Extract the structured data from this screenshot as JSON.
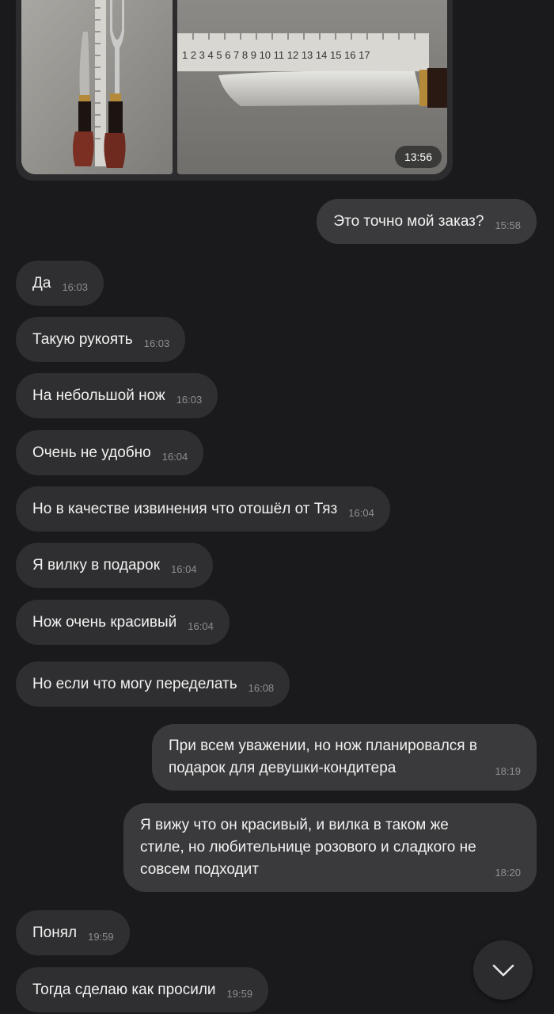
{
  "media_message": {
    "time": "13:56"
  },
  "ruler_numbers": "1 2 3 4 5 6 7 8 9 10 11 12 13 14 15 16 17",
  "messages": [
    {
      "text": "Это точно мой заказ?",
      "time": "15:58",
      "dir": "out"
    },
    {
      "text": "Да",
      "time": "16:03",
      "dir": "in"
    },
    {
      "text": "Такую рукоять",
      "time": "16:03",
      "dir": "in"
    },
    {
      "text": "На небольшой нож",
      "time": "16:03",
      "dir": "in"
    },
    {
      "text": "Очень не удобно",
      "time": "16:04",
      "dir": "in"
    },
    {
      "text": "Но в качестве извинения что отошёл от Тяз",
      "time": "16:04",
      "dir": "in"
    },
    {
      "text": "Я вилку в подарок",
      "time": "16:04",
      "dir": "in"
    },
    {
      "text": "Нож очень красивый",
      "time": "16:04",
      "dir": "in"
    },
    {
      "text": "Но если что могу переделать",
      "time": "16:08",
      "dir": "in"
    },
    {
      "lines": [
        "При всем уважении, но нож планировался в",
        "подарок для девушки-кондитера"
      ],
      "time": "18:19",
      "dir": "out"
    },
    {
      "lines": [
        "Я вижу что он красивый, и вилка в таком же",
        "стиле, но любительнице розового и сладкого не",
        "совсем подходит"
      ],
      "time": "18:20",
      "dir": "out"
    },
    {
      "text": "Понял",
      "time": "19:59",
      "dir": "in"
    },
    {
      "text": "Тогда сделаю как просили",
      "time": "19:59",
      "dir": "in"
    }
  ],
  "scroll_down_icon": "chevron-down-icon",
  "colors": {
    "background": "#1a1a1c",
    "incoming_bubble": "#2f2f31",
    "outgoing_bubble": "#3a3a3c",
    "timestamp": "#8e8e93"
  }
}
